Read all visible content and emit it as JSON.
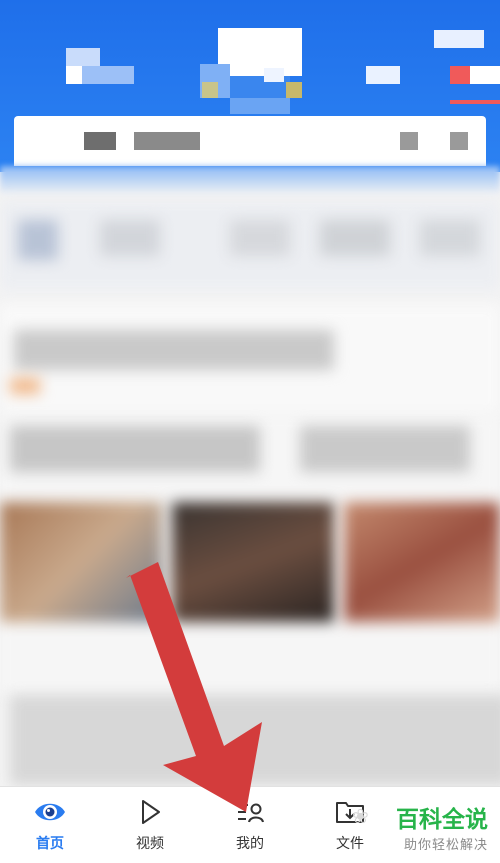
{
  "header": {
    "colors": {
      "primary": "#2c82f2",
      "accent_red": "#f05a5a"
    }
  },
  "search": {
    "placeholder": ""
  },
  "overlay": {
    "arrow_color": "#d33c3c",
    "arrow_points_to": "bottom_nav.items.2"
  },
  "bottom_nav": {
    "items": [
      {
        "label": "首页",
        "icon": "eye-icon",
        "active": true
      },
      {
        "label": "视频",
        "icon": "play-icon",
        "active": false
      },
      {
        "label": "我的",
        "icon": "user-list-icon",
        "active": false
      },
      {
        "label": "文件",
        "icon": "folder-download-icon",
        "active": false
      }
    ],
    "active_color": "#2a7cf0"
  },
  "watermark": {
    "title": "百科全说",
    "subtitle": "助你轻松解决"
  }
}
